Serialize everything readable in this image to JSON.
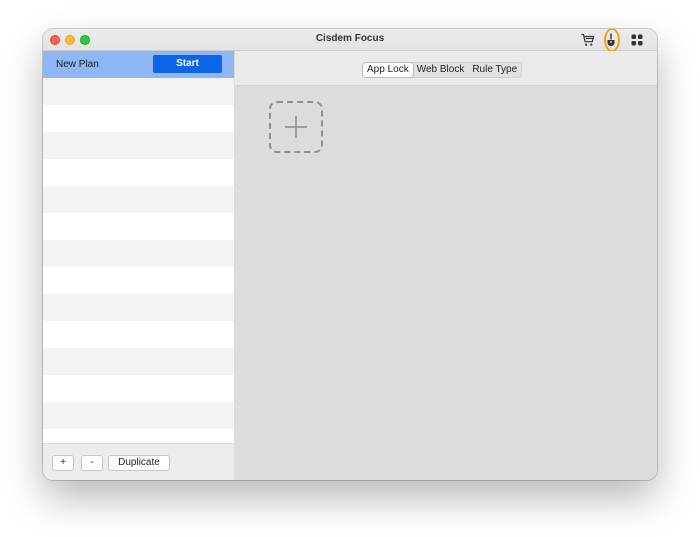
{
  "window": {
    "title": "Cisdem Focus",
    "toolbar_icons": [
      "cart-icon",
      "paint-brush-icon",
      "grid-icon"
    ],
    "accent_highlight_color": "#f3a21c"
  },
  "sidebar": {
    "plans": [
      {
        "name": "New Plan",
        "action_label": "Start"
      }
    ],
    "footer": {
      "add_label": "+",
      "remove_label": "-",
      "duplicate_label": "Duplicate"
    }
  },
  "main": {
    "tabs": [
      {
        "label": "App Lock",
        "active": true
      },
      {
        "label": "Web Block",
        "active": false
      },
      {
        "label": "Rule Type",
        "active": false
      }
    ],
    "add_tile_icon": "plus-icon"
  },
  "colors": {
    "selected_plan_bg": "#8fb7f5",
    "start_button_bg": "#0a66e6"
  }
}
